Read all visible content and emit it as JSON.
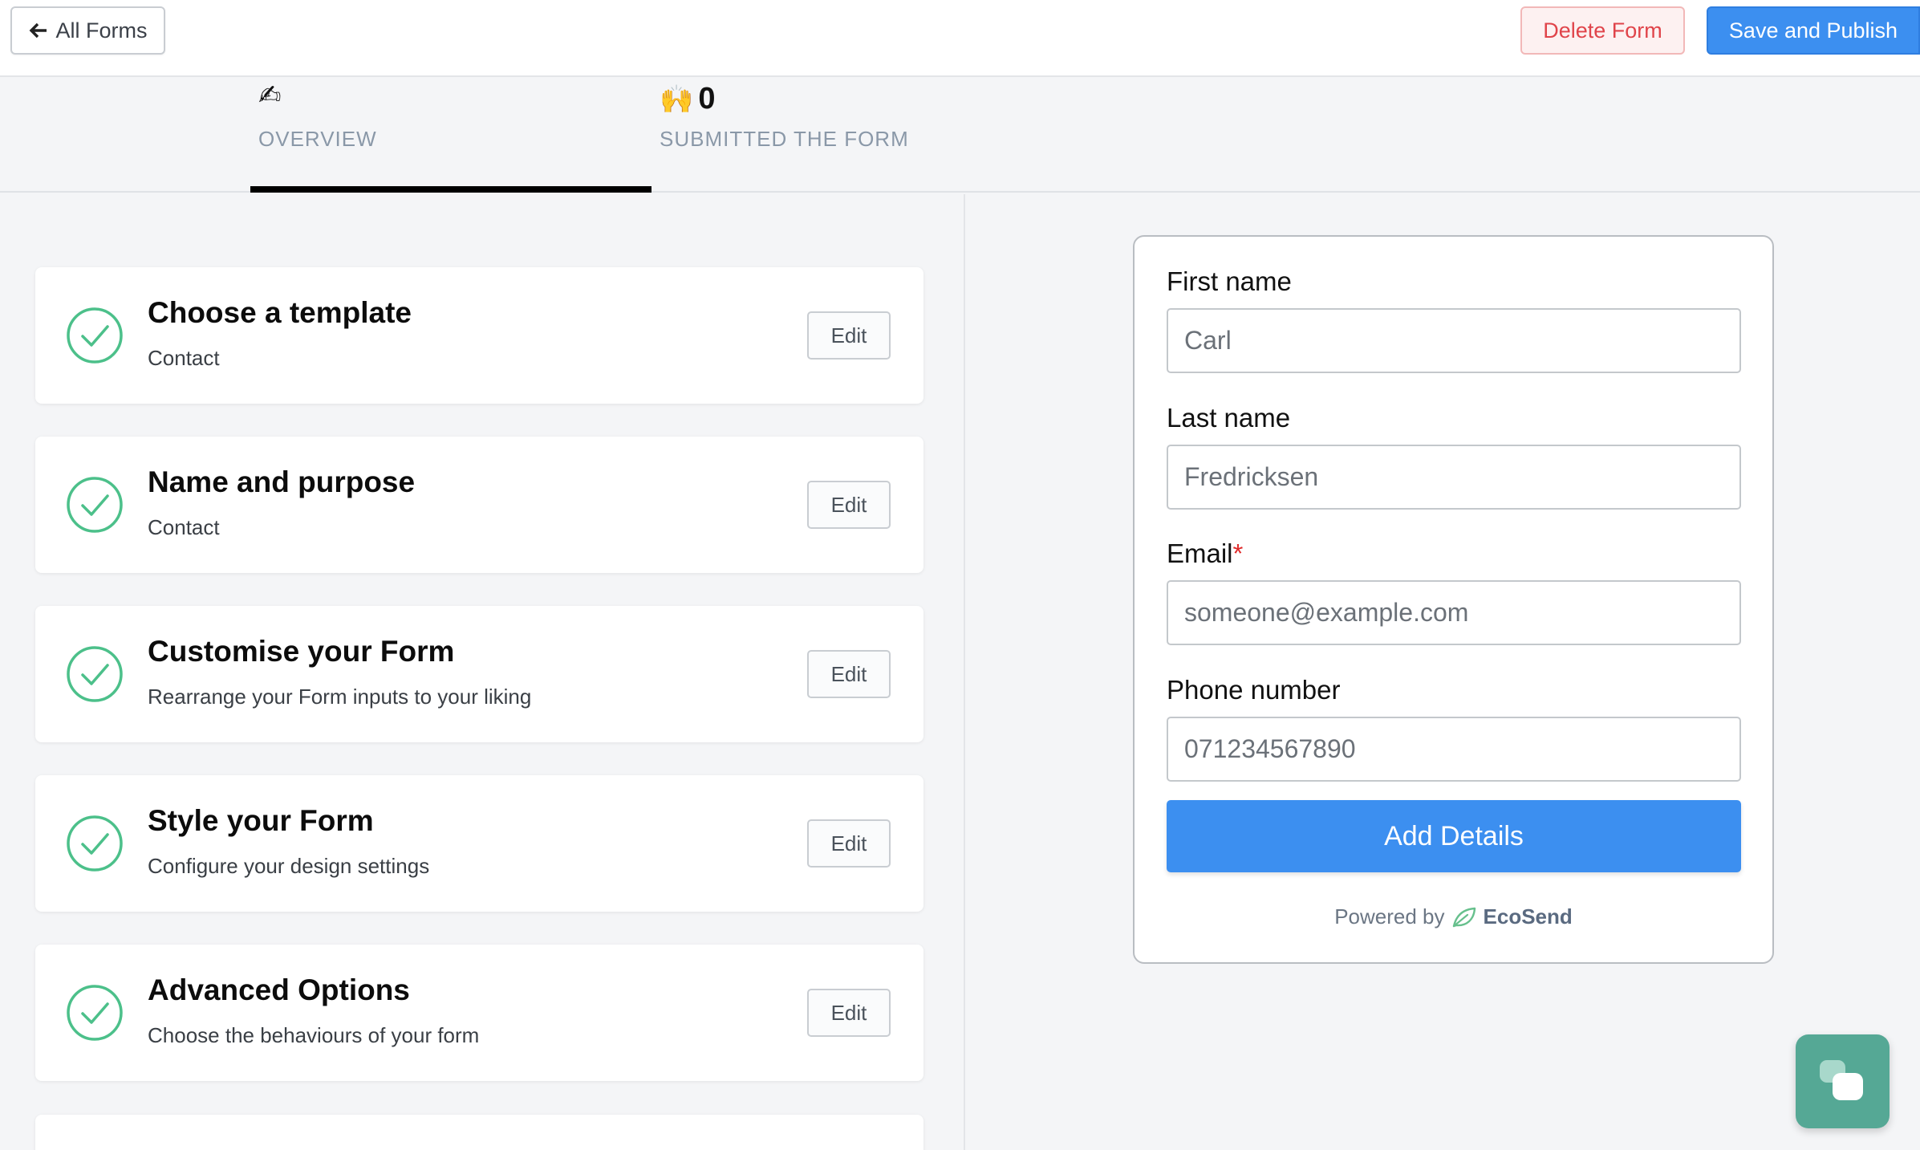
{
  "header": {
    "back_label": "All Forms",
    "delete_label": "Delete Form",
    "publish_label": "Save and Publish"
  },
  "tabs": {
    "overview": {
      "emoji": "✍",
      "label": "OVERVIEW"
    },
    "submitted": {
      "emoji": "🙌",
      "count": "0",
      "label": "SUBMITTED THE FORM"
    }
  },
  "steps": [
    {
      "title": "Choose a template",
      "subtitle": "Contact",
      "action": "Edit"
    },
    {
      "title": "Name and purpose",
      "subtitle": "Contact",
      "action": "Edit"
    },
    {
      "title": "Customise your Form",
      "subtitle": "Rearrange your Form inputs to your liking",
      "action": "Edit"
    },
    {
      "title": "Style your Form",
      "subtitle": "Configure your design settings",
      "action": "Edit"
    },
    {
      "title": "Advanced Options",
      "subtitle": "Choose the behaviours of your form",
      "action": "Edit"
    }
  ],
  "form_preview": {
    "fields": [
      {
        "label": "First name",
        "placeholder": "Carl",
        "required": false
      },
      {
        "label": "Last name",
        "placeholder": "Fredricksen",
        "required": false
      },
      {
        "label": "Email",
        "placeholder": "someone@example.com",
        "required": true,
        "required_mark": "*"
      },
      {
        "label": "Phone number",
        "placeholder": "071234567890",
        "required": false
      }
    ],
    "submit_label": "Add Details",
    "powered_by": "Powered by",
    "brand": "EcoSend"
  },
  "colors": {
    "primary": "#3c8ff0",
    "danger": "#e0444a",
    "success": "#4cc08a",
    "chat": "#55a895"
  }
}
